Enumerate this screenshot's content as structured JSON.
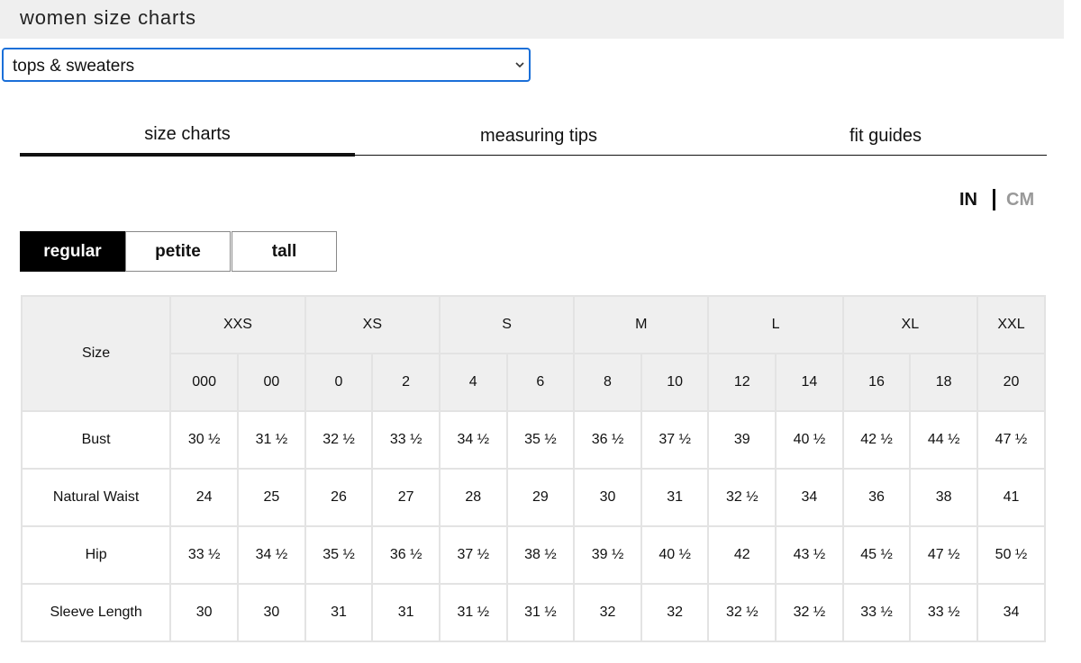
{
  "header": {
    "title": "women size charts"
  },
  "category_select": {
    "value": "tops & sweaters"
  },
  "tabs": [
    {
      "label": "size charts",
      "active": true
    },
    {
      "label": "measuring tips",
      "active": false
    },
    {
      "label": "fit guides",
      "active": false
    }
  ],
  "units": {
    "in": "IN",
    "cm": "CM",
    "selected": "IN"
  },
  "fit_options": [
    {
      "label": "regular",
      "active": true
    },
    {
      "label": "petite",
      "active": false
    },
    {
      "label": "tall",
      "active": false
    }
  ],
  "table": {
    "corner_label": "Size",
    "size_groups": [
      {
        "label": "XXS",
        "span": 2
      },
      {
        "label": "XS",
        "span": 2
      },
      {
        "label": "S",
        "span": 2
      },
      {
        "label": "M",
        "span": 2
      },
      {
        "label": "L",
        "span": 2
      },
      {
        "label": "XL",
        "span": 2
      },
      {
        "label": "XXL",
        "span": 1
      }
    ],
    "numeric_sizes": [
      "000",
      "00",
      "0",
      "2",
      "4",
      "6",
      "8",
      "10",
      "12",
      "14",
      "16",
      "18",
      "20"
    ],
    "rows": [
      {
        "label": "Bust",
        "values": [
          "30 ½",
          "31 ½",
          "32 ½",
          "33 ½",
          "34 ½",
          "35 ½",
          "36 ½",
          "37 ½",
          "39",
          "40 ½",
          "42 ½",
          "44 ½",
          "47 ½"
        ]
      },
      {
        "label": "Natural Waist",
        "values": [
          "24",
          "25",
          "26",
          "27",
          "28",
          "29",
          "30",
          "31",
          "32 ½",
          "34",
          "36",
          "38",
          "41"
        ]
      },
      {
        "label": "Hip",
        "values": [
          "33 ½",
          "34 ½",
          "35 ½",
          "36 ½",
          "37 ½",
          "38 ½",
          "39 ½",
          "40 ½",
          "42",
          "43 ½",
          "45 ½",
          "47 ½",
          "50 ½"
        ]
      },
      {
        "label": "Sleeve Length",
        "values": [
          "30",
          "30",
          "31",
          "31",
          "31 ½",
          "31 ½",
          "32",
          "32",
          "32 ½",
          "32 ½",
          "33 ½",
          "33 ½",
          "34"
        ]
      }
    ]
  }
}
